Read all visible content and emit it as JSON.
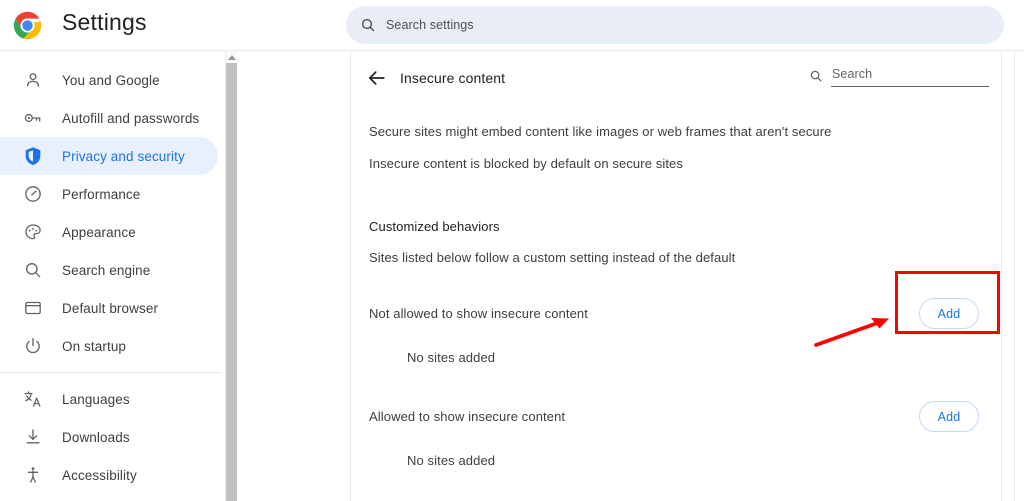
{
  "window": {
    "app_title": "Settings",
    "logo_icon": "chrome-logo"
  },
  "search": {
    "icon": "search-icon",
    "placeholder": "Search settings",
    "value": ""
  },
  "sidebar": {
    "items": [
      {
        "label": "You and Google",
        "icon": "person-icon",
        "active": false
      },
      {
        "label": "Autofill and passwords",
        "icon": "key-icon",
        "active": false
      },
      {
        "label": "Privacy and security",
        "icon": "shield-icon",
        "active": true
      },
      {
        "label": "Performance",
        "icon": "speedometer-icon",
        "active": false
      },
      {
        "label": "Appearance",
        "icon": "palette-icon",
        "active": false
      },
      {
        "label": "Search engine",
        "icon": "magnifier-icon",
        "active": false
      },
      {
        "label": "Default browser",
        "icon": "browser-window-icon",
        "active": false
      },
      {
        "label": "On startup",
        "icon": "power-icon",
        "active": false
      }
    ],
    "items_group2": [
      {
        "label": "Languages",
        "icon": "translate-icon",
        "active": false
      },
      {
        "label": "Downloads",
        "icon": "download-icon",
        "active": false
      },
      {
        "label": "Accessibility",
        "icon": "accessibility-icon",
        "active": false
      }
    ]
  },
  "content": {
    "back_icon": "back-arrow-icon",
    "title": "Insecure content",
    "inner_search": {
      "icon": "search-icon",
      "placeholder": "Search",
      "value": ""
    },
    "descriptions": [
      "Secure sites might embed content like images or web frames that aren't secure",
      "Insecure content is blocked by default on secure sites"
    ],
    "section_title": "Customized behaviors",
    "section_subtitle": "Sites listed below follow a custom setting instead of the default",
    "permission_rows": [
      {
        "label": "Not allowed to show insecure content",
        "add_label": "Add",
        "empty_text": "No sites added",
        "highlighted": true
      },
      {
        "label": "Allowed to show insecure content",
        "add_label": "Add",
        "empty_text": "No sites added",
        "highlighted": false
      }
    ]
  },
  "annotations": {
    "highlight_color": "#ff0000",
    "arrow_color": "#ff0000",
    "target": "add-button-not-allowed"
  },
  "colors": {
    "accent_blue": "#1a73e8",
    "active_pill": "#e8f0fe",
    "search_bg": "#e9edf7",
    "text_primary": "#202124",
    "text_secondary": "#3c4043"
  }
}
